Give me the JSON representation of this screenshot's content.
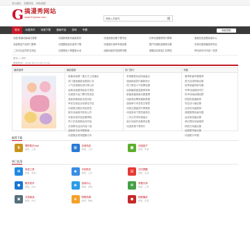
{
  "topbar": {
    "links": [
      "设为首页",
      "收藏本站",
      "网站地图"
    ]
  },
  "logo": {
    "letter": "G",
    "name": "搞漫秀网站",
    "url": "www.52gman.com"
  },
  "search": {
    "placeholder": "请输入关键词",
    "button": "搜"
  },
  "nav": {
    "items": [
      "首页",
      "动漫资讯",
      "动漫下载",
      "漫画作品",
      "游戏",
      "专题"
    ],
    "side_label": "网站导航",
    "active_color": "#c41a27"
  },
  "links": [
    "动漫·新番动画每日更新",
    "动漫新闻资讯最新发布",
    "动漫资源合集下载专区",
    "日本动漫推荐排行榜单",
    "漫画在线连载阅读中心",
    "动漫周边产品热门推荐",
    "动漫壁纸高清素材下载",
    "动漫音乐原声专辑合集",
    "国产动漫精品推荐合集",
    "手游动漫改编游戏专区",
    "二次元社区同好交流区",
    "动漫角色人物图鉴大全",
    "经典动画怀旧回顾专题",
    "漫展活动信息汇总预告",
    "声优资讯与作品一览表"
  ],
  "crumb": "首页 > 资讯",
  "pinfo": "更新时间：2018-09-23 09:21:02",
  "columns": [
    {
      "title": "最新推荐",
      "items": []
    },
    {
      "title": "最新更新",
      "items": [
        "新番动画第一集正式上线播出",
        "热门漫画最新话更新汇总",
        "人气动漫角色排行榜公布",
        "经典动画剧场版官方预告",
        "动漫音乐会门票开售信息",
        "漫画改编电影定档消息",
        "声优见面会活动报名开启",
        "动漫周边限定商品发售",
        "新作动画制作阵容公开",
        "年度动漫评选结果揭晓",
        "同人作品投稿活动开始",
        "手游联动活动内容介绍",
        "漫画家访谈专题报道",
        "动漫展会现场图集分享"
      ]
    },
    {
      "title": "热门排行",
      "items": [
        "本周最受欢迎动画盘点",
        "漫画销量排行最新统计",
        "热门角色人气投票结果",
        "经典番剧重温推荐清单",
        "新番追番指南合集整理",
        "动画电影票房最新数据",
        "漫画单行本发售日程表",
        "动漫主题曲排行榜更新",
        "动漫游戏下载热度排名",
        "二次元热词年度盘点",
        "高分动画作品推荐合集",
        "动漫资源下载排行"
      ]
    },
    {
      "title": "专题",
      "items": [
        "春季新番专题推荐",
        "夏日动漫特辑合集",
        "秋季追番导航专题",
        "冬季动画精选专栏",
        "机甲动画经典回顾",
        "校园恋爱番推荐",
        "热血战斗番合集",
        "治愈系动画推荐",
        "悬疑推理动画专题",
        "运动竞技番合集",
        "奇幻冒险动画推荐",
        "搞笑日常番合集",
        "经典剧场版合集",
        "动漫配乐专题"
      ]
    }
  ],
  "section1": {
    "title": "推荐下载",
    "apps": [
      {
        "icon": "money-bag-icon",
        "color": "#c8931b",
        "glyph": "$",
        "name": "理财助手app",
        "sub": "类型：工具"
      },
      {
        "icon": "app-store-icon",
        "color": "#2a7bd4",
        "glyph": "▦",
        "name": "应用商店",
        "sub": "类型：工具"
      },
      {
        "icon": "green-box-icon",
        "color": "#5caf2d",
        "glyph": "■",
        "name": "动漫盒子",
        "sub": "类型：影音"
      },
      {
        "icon": "",
        "color": "",
        "glyph": "",
        "name": "",
        "sub": ""
      }
    ]
  },
  "section2": {
    "title": "热门应用",
    "apps": [
      {
        "icon": "windows-icon",
        "color": "#1e88e5",
        "glyph": "⊞",
        "name": "系统工具",
        "sub": "类型：系统"
      },
      {
        "icon": "blue-app-icon",
        "color": "#3a8ee6",
        "glyph": "◆",
        "name": "手机助手",
        "sub": "类型：工具"
      },
      {
        "icon": "calendar-icon",
        "color": "#e53935",
        "glyph": "▤",
        "name": "日历提醒",
        "sub": "类型：生活"
      },
      {
        "icon": "",
        "color": "",
        "glyph": "",
        "name": "",
        "sub": ""
      },
      {
        "icon": "chat-bubble-icon",
        "color": "#1976d2",
        "glyph": "●",
        "name": "聊天软件",
        "sub": "类型：社交"
      },
      {
        "icon": "game-controller-icon",
        "color": "#2b9be8",
        "glyph": "◉",
        "name": "游戏中心",
        "sub": "类型：游戏"
      },
      {
        "icon": "leaf-icon",
        "color": "#43a047",
        "glyph": "✿",
        "name": "清理大师",
        "sub": "类型：工具"
      },
      {
        "icon": "",
        "color": "",
        "glyph": "",
        "name": "",
        "sub": ""
      },
      {
        "icon": "document-icon",
        "color": "#546e7a",
        "glyph": "▣",
        "name": "文档阅读",
        "sub": "类型：办公"
      },
      {
        "icon": "cart-icon",
        "color": "#f4a12b",
        "glyph": "◈",
        "name": "购物商城",
        "sub": "类型：购物"
      },
      {
        "icon": "red-apple-icon",
        "color": "#c62828",
        "glyph": "●",
        "name": "视频播放",
        "sub": "类型：影音"
      },
      {
        "icon": "",
        "color": "",
        "glyph": "",
        "name": "",
        "sub": ""
      }
    ]
  }
}
